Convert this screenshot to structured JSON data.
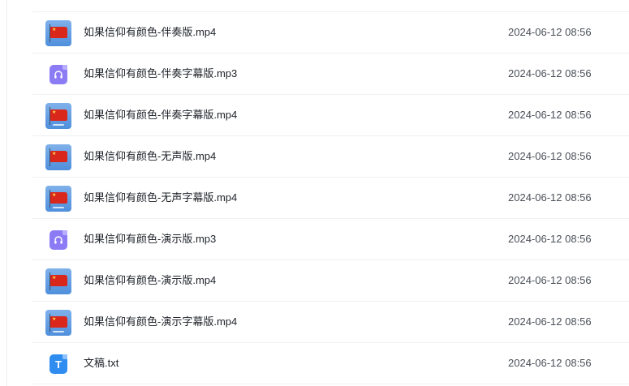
{
  "files": [
    {
      "type": "video",
      "icon": "video-thumbnail-icon",
      "name": "如果信仰有颜色-伴奏版.mp4",
      "date": "2024-06-12 08:56"
    },
    {
      "type": "audio",
      "icon": "audio-file-icon",
      "name": "如果信仰有颜色-伴奏字幕版.mp3",
      "date": "2024-06-12 08:56"
    },
    {
      "type": "video",
      "icon": "video-thumbnail-icon",
      "name": "如果信仰有颜色-伴奏字幕版.mp4",
      "date": "2024-06-12 08:56"
    },
    {
      "type": "video",
      "icon": "video-thumbnail-icon",
      "name": "如果信仰有颜色-无声版.mp4",
      "date": "2024-06-12 08:56"
    },
    {
      "type": "video",
      "icon": "video-thumbnail-icon",
      "name": "如果信仰有颜色-无声字幕版.mp4",
      "date": "2024-06-12 08:56"
    },
    {
      "type": "audio",
      "icon": "audio-file-icon",
      "name": "如果信仰有颜色-演示版.mp3",
      "date": "2024-06-12 08:56"
    },
    {
      "type": "video",
      "icon": "video-thumbnail-icon",
      "name": "如果信仰有颜色-演示版.mp4",
      "date": "2024-06-12 08:56"
    },
    {
      "type": "video",
      "icon": "video-thumbnail-icon",
      "name": "如果信仰有颜色-演示字幕版.mp4",
      "date": "2024-06-12 08:56"
    },
    {
      "type": "text",
      "icon": "text-file-icon",
      "name": "文稿.txt",
      "date": "2024-06-12 08:56",
      "glyph": "T"
    }
  ],
  "colors": {
    "audio_icon": "#8b7cf6",
    "text_icon": "#2f8cf0",
    "video_flag": "#d9271c"
  }
}
